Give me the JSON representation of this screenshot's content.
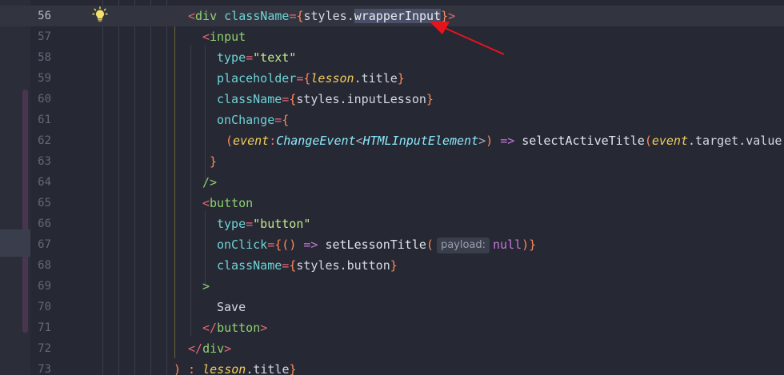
{
  "editor": {
    "lines": [
      {
        "num": "56",
        "current": true
      },
      {
        "num": "57"
      },
      {
        "num": "58"
      },
      {
        "num": "59"
      },
      {
        "num": "60"
      },
      {
        "num": "61"
      },
      {
        "num": "62"
      },
      {
        "num": "63"
      },
      {
        "num": "64"
      },
      {
        "num": "65"
      },
      {
        "num": "66"
      },
      {
        "num": "67"
      },
      {
        "num": "68"
      },
      {
        "num": "69"
      },
      {
        "num": "70"
      },
      {
        "num": "71"
      },
      {
        "num": "72"
      },
      {
        "num": "73"
      }
    ],
    "tokens": {
      "lt": "<",
      "gt": ">",
      "slash_gt": "/>",
      "lt_slash": "</",
      "eq": "=",
      "lbrace": "{",
      "rbrace": "}",
      "lparen": "(",
      "rparen": ")",
      "dot": ".",
      "colon": ":",
      "arrow": "=>",
      "div": "div",
      "input": "input",
      "button": "button",
      "className": "className",
      "type": "type",
      "placeholder": "placeholder",
      "onChange": "onChange",
      "onClick": "onClick",
      "styles": "styles",
      "wrapperInput": "wrapperInput",
      "inputLesson": "inputLesson",
      "buttonProp": "button",
      "str_text": "\"text\"",
      "str_button": "\"button\"",
      "lesson": "lesson",
      "title": "title",
      "event": "event",
      "ChangeEvent": "ChangeEvent",
      "HTMLInputElement": "HTMLInputElement",
      "selectActiveTitle": "selectActiveTitle",
      "target": "target",
      "value": "value",
      "setLessonTitle": "setLessonTitle",
      "payload_hint": "payload:",
      "null": "null",
      "save_text": "Save",
      "ternary_else": ") : "
    },
    "colors": {
      "background": "#262833",
      "arrow": "#e8141c"
    },
    "icons": {
      "bulb": "lightbulb-icon"
    }
  }
}
